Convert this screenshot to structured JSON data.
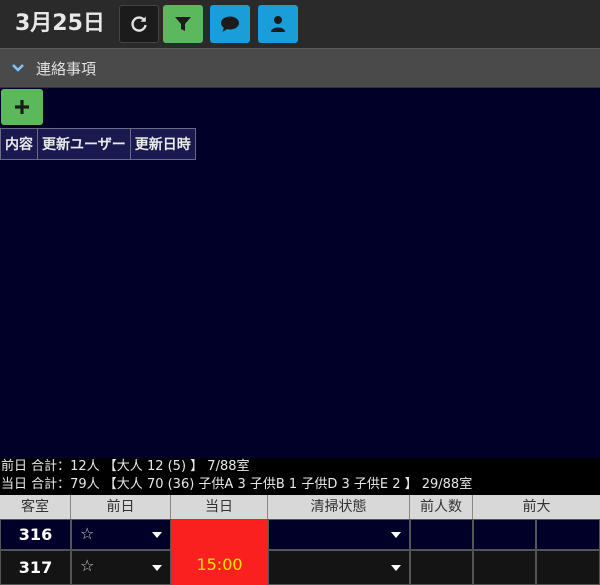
{
  "header": {
    "date": "3月25日",
    "buttons": {
      "refresh_icon": "refresh-icon",
      "filter_icon": "filter-icon",
      "chat_icon": "chat-icon",
      "user_icon": "user-icon"
    },
    "colors": {
      "filter": "#5cb85c",
      "chat": "#1a9ed9",
      "user": "#1a9ed9"
    }
  },
  "section": {
    "title": "連絡事項"
  },
  "notes": {
    "columns": [
      "内容",
      "更新ユーザー",
      "更新日時"
    ]
  },
  "summary": {
    "prev_line": "前日 合計：12人 【大人 12 (5) 】 7/88室",
    "today_line": "当日 合計：79人 【大人 70 (36) 子供A 3 子供B 1 子供D 3 子供E 2 】 29/88室"
  },
  "grid": {
    "headers": [
      "客室",
      "前日",
      "当日",
      "清掃状態",
      "前人数",
      "前大"
    ],
    "rows": [
      {
        "room": "316",
        "prev_star": "☆"
      },
      {
        "room": "317",
        "prev_star": "☆"
      }
    ],
    "today_time": "15:00",
    "today_color": "#fb2020"
  }
}
